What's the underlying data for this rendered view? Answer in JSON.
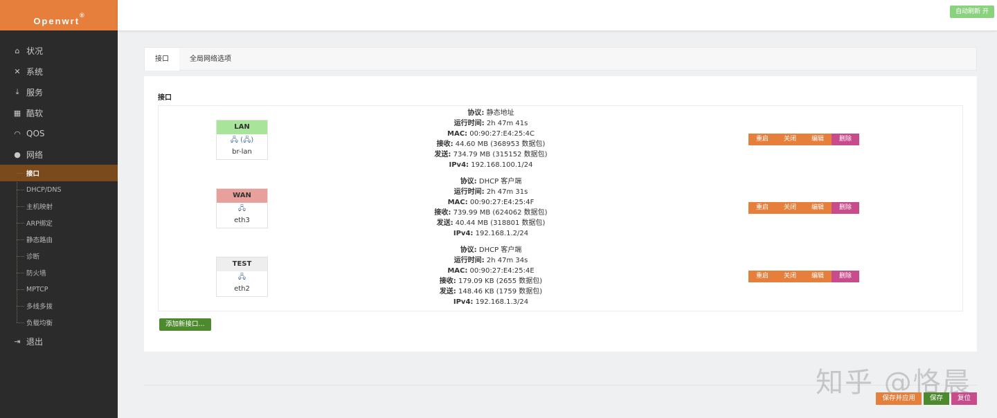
{
  "brand": {
    "name": "Openwrt",
    "mark": "®"
  },
  "sidebar": {
    "items": [
      {
        "icon": "home-icon",
        "glyph": "⌂",
        "label": "状况"
      },
      {
        "icon": "tools-icon",
        "glyph": "✕",
        "label": "系统"
      },
      {
        "icon": "download-icon",
        "glyph": "⤓",
        "label": "服务"
      },
      {
        "icon": "calendar-icon",
        "glyph": "▦",
        "label": "酷软"
      },
      {
        "icon": "gauge-icon",
        "glyph": "◠",
        "label": "QOS"
      },
      {
        "icon": "globe-icon",
        "glyph": "●",
        "label": "网络"
      }
    ],
    "network_sub": [
      "接口",
      "DHCP/DNS",
      "主机映射",
      "ARP绑定",
      "静态路由",
      "诊断",
      "防火墙",
      "MPTCP",
      "多线多拨",
      "负载均衡"
    ],
    "logout": {
      "icon": "logout-icon",
      "glyph": "⇥",
      "label": "退出"
    }
  },
  "header": {
    "refresh_label": "自动刷新 开"
  },
  "tabs": [
    "接口",
    "全局网络选项"
  ],
  "section_title": "接口",
  "interfaces": [
    {
      "name": "LAN",
      "color": "#a8e59a",
      "icons": "🖧 (🖧)",
      "device": "br-lan",
      "protocol_label": "协议:",
      "protocol": "静态地址",
      "uptime_label": "运行时间:",
      "uptime": "2h 47m 41s",
      "mac_label": "MAC:",
      "mac": "00:90:27:E4:25:4C",
      "rx_label": "接收:",
      "rx": "44.60 MB (368953 数据包)",
      "tx_label": "发送:",
      "tx": "734.79 MB (315152 数据包)",
      "ipv4_label": "IPv4:",
      "ipv4": "192.168.100.1/24"
    },
    {
      "name": "WAN",
      "color": "#e8a09c",
      "icons": "🖧",
      "device": "eth3",
      "protocol_label": "协议:",
      "protocol": "DHCP 客户端",
      "uptime_label": "运行时间:",
      "uptime": "2h 47m 31s",
      "mac_label": "MAC:",
      "mac": "00:90:27:E4:25:4F",
      "rx_label": "接收:",
      "rx": "739.99 MB (624062 数据包)",
      "tx_label": "发送:",
      "tx": "40.44 MB (318801 数据包)",
      "ipv4_label": "IPv4:",
      "ipv4": "192.168.1.2/24"
    },
    {
      "name": "TEST",
      "color": "#eeeeee",
      "icons": "🖧",
      "device": "eth2",
      "protocol_label": "协议:",
      "protocol": "DHCP 客户端",
      "uptime_label": "运行时间:",
      "uptime": "2h 47m 34s",
      "mac_label": "MAC:",
      "mac": "00:90:27:E4:25:4E",
      "rx_label": "接收:",
      "rx": "179.09 KB (2655 数据包)",
      "tx_label": "发送:",
      "tx": "148.46 KB (1759 数据包)",
      "ipv4_label": "IPv4:",
      "ipv4": "192.168.1.3/24"
    }
  ],
  "row_actions": {
    "restart": "重启",
    "stop": "关闭",
    "edit": "编辑",
    "delete": "删除"
  },
  "add_interface_label": "添加新接口...",
  "footer": {
    "save_apply": "保存并应用",
    "save": "保存",
    "reset": "复位"
  },
  "watermark": "知乎 @恪晨"
}
